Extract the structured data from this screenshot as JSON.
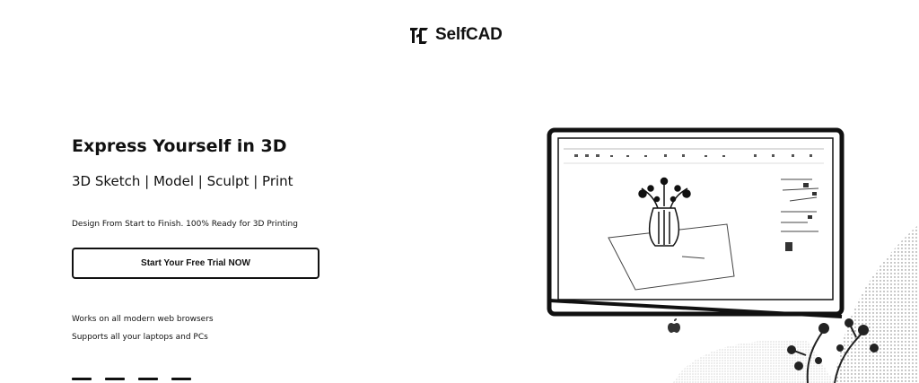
{
  "header": {
    "logo_text": "SelfCAD",
    "logo_icon": "selfcad-logo-icon"
  },
  "hero": {
    "headline": "Express Yourself in 3D",
    "subheadline": "3D Sketch | Model | Sculpt | Print",
    "tagline": "Design From Start to Finish. 100% Ready for 3D Printing",
    "cta_label": "Start Your Free Trial NOW",
    "features": [
      "Works on all modern web browsers",
      "Supports all your laptops and PCs"
    ]
  },
  "carousel": {
    "slide_count": 4,
    "active_index": 0
  },
  "illustration": {
    "monitor_icon": "imac-monitor-icon",
    "brand_icon": "apple-logo-icon",
    "model_icon": "vase-with-branches-icon",
    "decoration_icon": "tree-branches-icon"
  },
  "colors": {
    "text": "#111111",
    "background": "#ffffff",
    "button_border": "#111111"
  }
}
